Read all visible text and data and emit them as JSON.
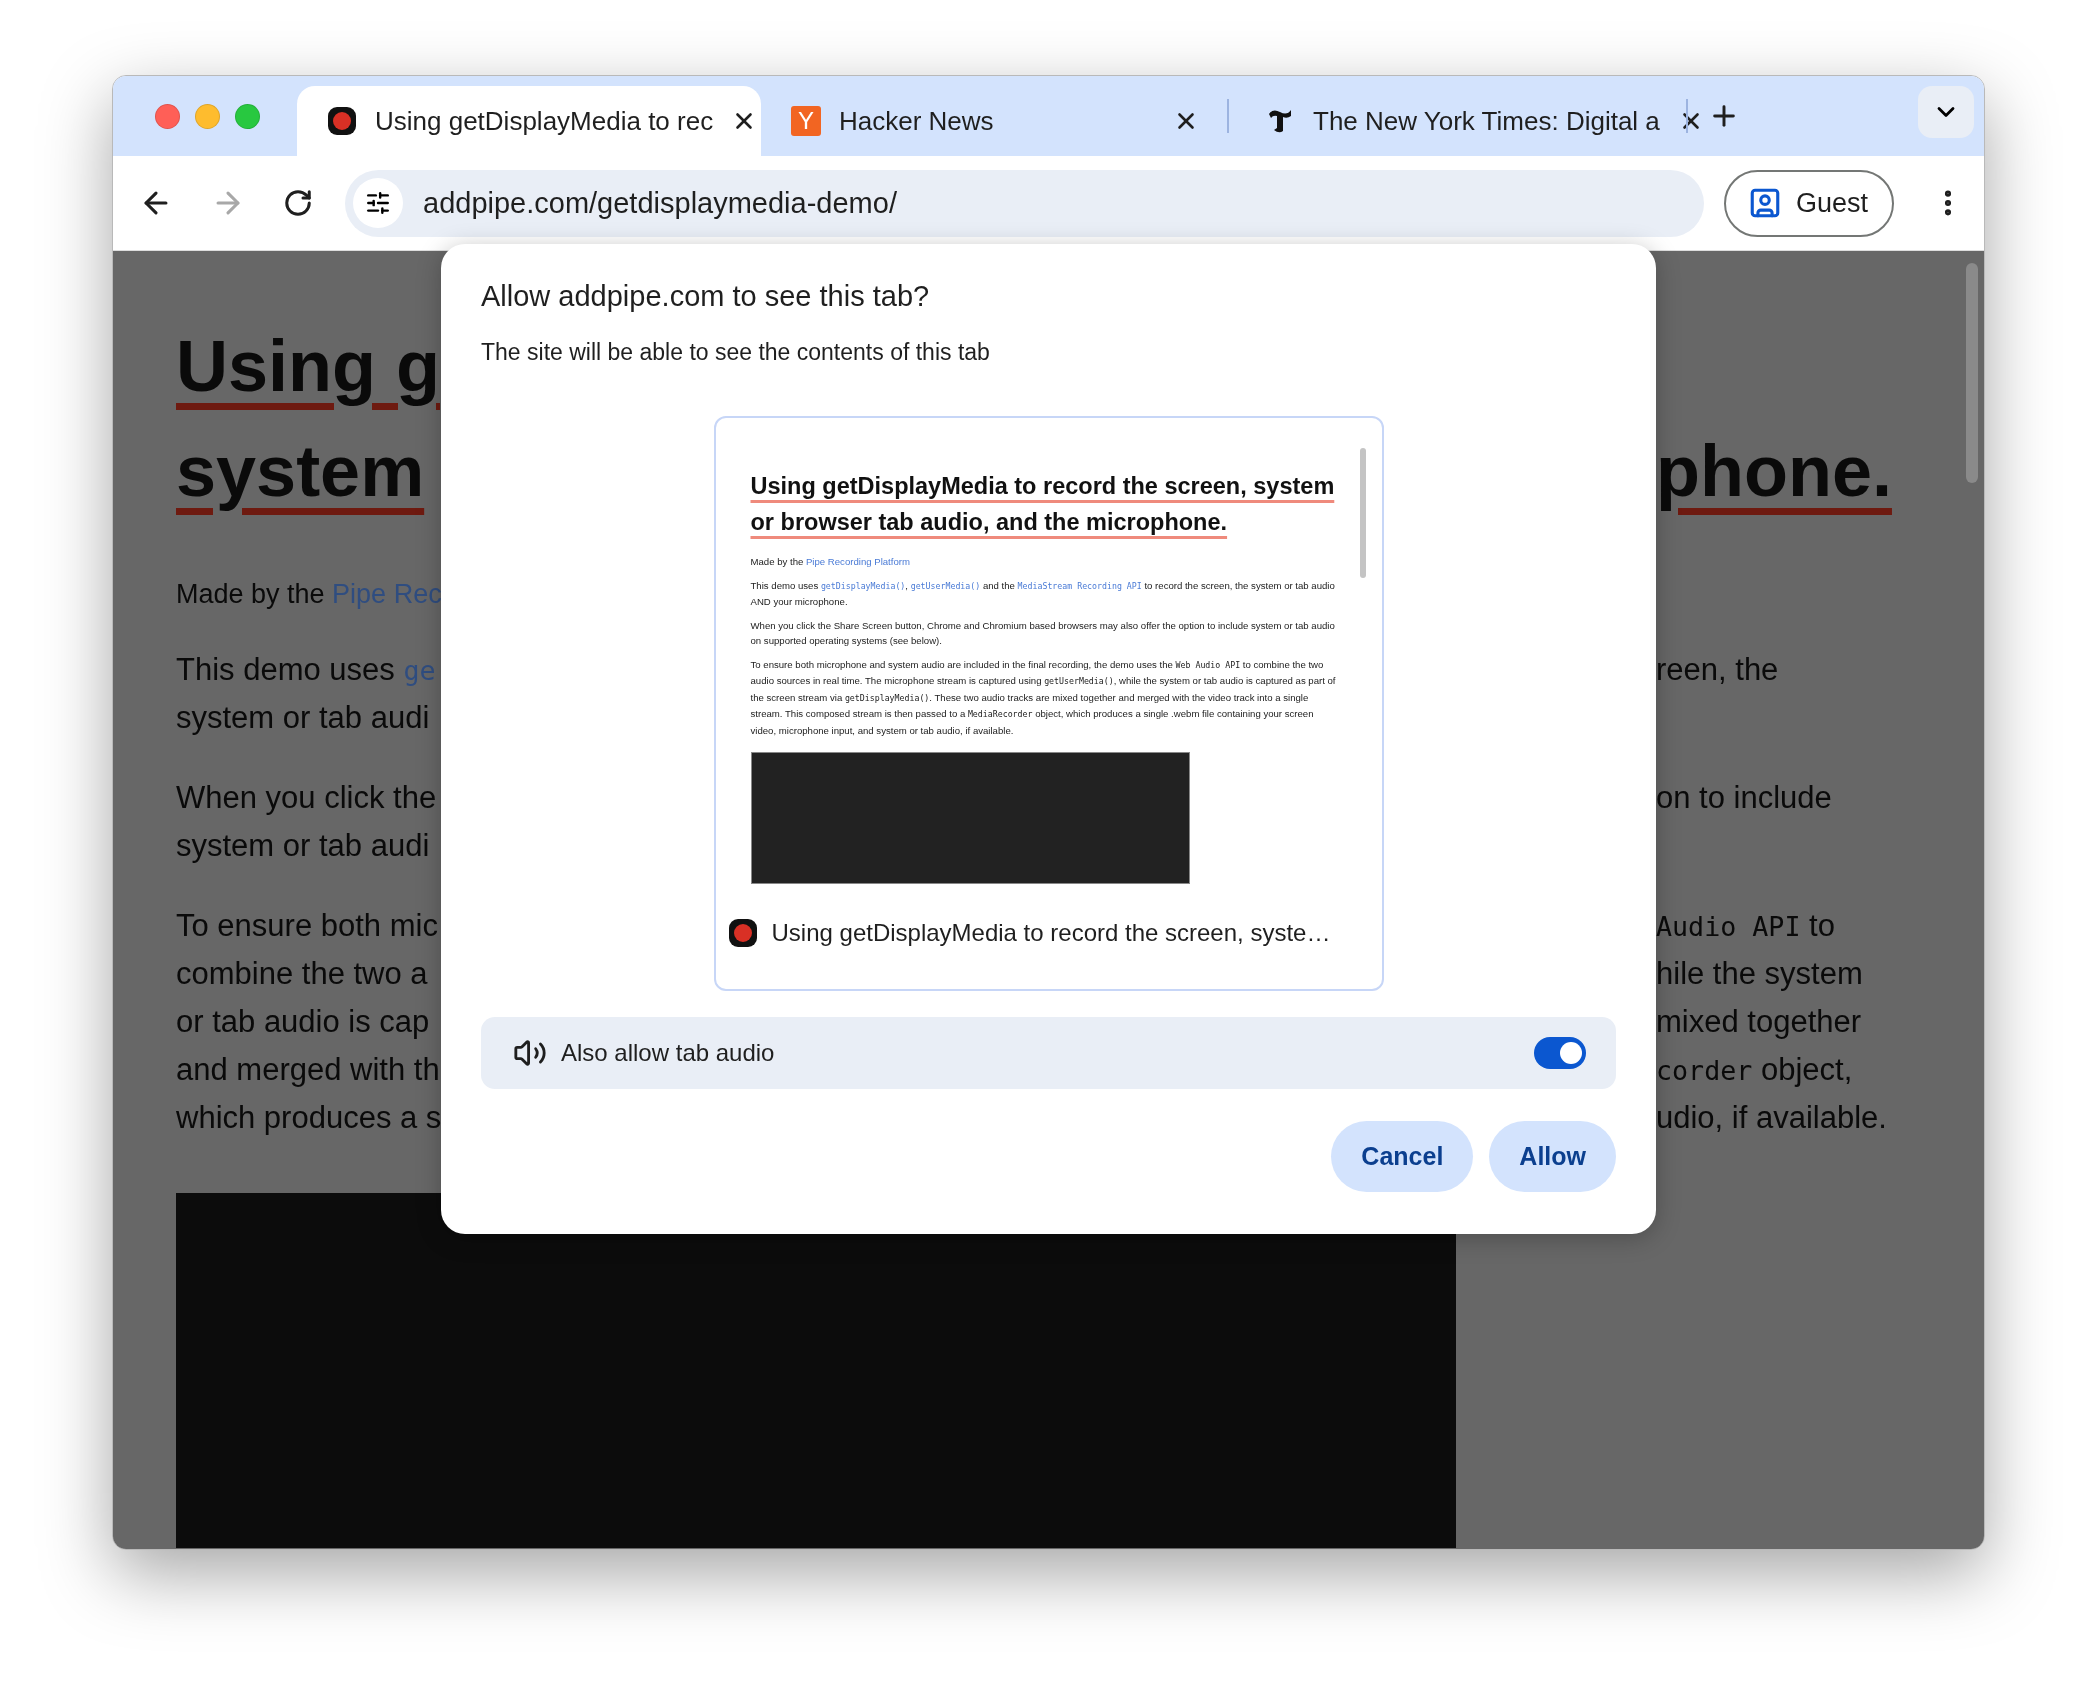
{
  "tabs": [
    {
      "title": "Using getDisplayMedia to rec",
      "selected": true,
      "kind": "record"
    },
    {
      "title": "Hacker News",
      "selected": false,
      "kind": "letter",
      "favicon_letter": "Y"
    },
    {
      "title": "The New York Times: Digital a",
      "selected": false,
      "kind": "blackletter"
    }
  ],
  "toolbar": {
    "url": "addpipe.com/getdisplaymedia-demo/",
    "forward_disabled": true,
    "profile": "Guest"
  },
  "page": {
    "blocks": [
      {
        "kind": "heading",
        "lines": [
          {
            "left": [
              {
                "kind": "text",
                "text": "Using g"
              }
            ]
          },
          {
            "left": [
              {
                "kind": "text",
                "text": "system"
              }
            ],
            "right": [
              {
                "kind": "text",
                "text": "phone."
              }
            ]
          }
        ]
      },
      {
        "kind": "byline",
        "lines": [
          {
            "left": [
              {
                "kind": "text",
                "text": "Made by the "
              },
              {
                "kind": "link",
                "text": "Pipe Rec"
              }
            ]
          }
        ]
      },
      {
        "kind": "paragraph",
        "lines": [
          {
            "left": [
              {
                "kind": "text",
                "text": "This demo uses "
              },
              {
                "kind": "code-link",
                "text": "ge"
              }
            ],
            "right": [
              {
                "kind": "text",
                "text": "reen, the"
              }
            ]
          },
          {
            "left": [
              {
                "kind": "text",
                "text": "system or tab audi"
              }
            ]
          }
        ]
      },
      {
        "kind": "paragraph",
        "lines": [
          {
            "left": [
              {
                "kind": "text",
                "text": "When you click the"
              }
            ],
            "right": [
              {
                "kind": "text",
                "text": "on to include"
              }
            ]
          },
          {
            "left": [
              {
                "kind": "text",
                "text": "system or tab audi"
              }
            ]
          }
        ]
      },
      {
        "kind": "paragraph",
        "lines": [
          {
            "left": [
              {
                "kind": "text",
                "text": "To ensure both mic"
              }
            ],
            "right": [
              {
                "kind": "code",
                "text": "Audio API"
              },
              {
                "kind": "text",
                "text": " to"
              }
            ]
          },
          {
            "left": [
              {
                "kind": "text",
                "text": "combine the two a"
              }
            ],
            "right": [
              {
                "kind": "text",
                "text": "hile the system"
              }
            ]
          },
          {
            "left": [
              {
                "kind": "text",
                "text": "or tab audio is cap"
              }
            ],
            "right": [
              {
                "kind": "text",
                "text": "mixed together"
              }
            ]
          },
          {
            "left": [
              {
                "kind": "text",
                "text": "and merged with th"
              }
            ],
            "right": [
              {
                "kind": "code",
                "text": "corder"
              },
              {
                "kind": "text",
                "text": " object,"
              }
            ]
          },
          {
            "left": [
              {
                "kind": "text",
                "text": "which produces a s"
              }
            ],
            "right": [
              {
                "kind": "text",
                "text": "udio, if available."
              }
            ]
          }
        ]
      }
    ]
  },
  "dialog": {
    "title": "Allow addpipe.com to see this tab?",
    "subtitle": "The site will be able to see the contents of this tab",
    "preview": {
      "heading": "Using getDisplayMedia to record the screen, system or browser tab audio, and the microphone.",
      "paragraphs": [
        [
          {
            "kind": "text",
            "text": "Made by the "
          },
          {
            "kind": "link",
            "text": "Pipe Recording Platform"
          }
        ],
        [
          {
            "kind": "text",
            "text": "This demo uses "
          },
          {
            "kind": "code-link",
            "text": "getDisplayMedia()"
          },
          {
            "kind": "text",
            "text": ", "
          },
          {
            "kind": "code-link",
            "text": "getUserMedia()"
          },
          {
            "kind": "text",
            "text": " and the "
          },
          {
            "kind": "code-link",
            "text": "MediaStream Recording API"
          },
          {
            "kind": "text",
            "text": " to record the screen, the system or tab audio AND your microphone."
          }
        ],
        [
          {
            "kind": "text",
            "text": "When you click the Share Screen button, Chrome and Chromium based browsers may also offer the option to include system or tab audio on supported operating systems (see below)."
          }
        ],
        [
          {
            "kind": "text",
            "text": "To ensure both microphone and system audio are included in the final recording, the demo uses the "
          },
          {
            "kind": "code",
            "text": "Web Audio API"
          },
          {
            "kind": "text",
            "text": " to combine the two audio sources in real time. The microphone stream is captured using "
          },
          {
            "kind": "code",
            "text": "getUserMedia()"
          },
          {
            "kind": "text",
            "text": ", while the system or tab audio is captured as part of the screen stream via "
          },
          {
            "kind": "code",
            "text": "getDisplayMedia()"
          },
          {
            "kind": "text",
            "text": ". These two audio tracks are mixed together and merged with the video track into a single stream. This composed stream is then passed to a "
          },
          {
            "kind": "code",
            "text": "MediaRecorder"
          },
          {
            "kind": "text",
            "text": " object, which produces a single .webm file containing your screen video, microphone input, and system or tab audio, if available."
          }
        ]
      ],
      "caption": "Using getDisplayMedia to record the screen, syste…"
    },
    "audio_option": {
      "label": "Also allow tab audio",
      "on": true
    },
    "buttons": [
      "Cancel",
      "Allow"
    ]
  }
}
